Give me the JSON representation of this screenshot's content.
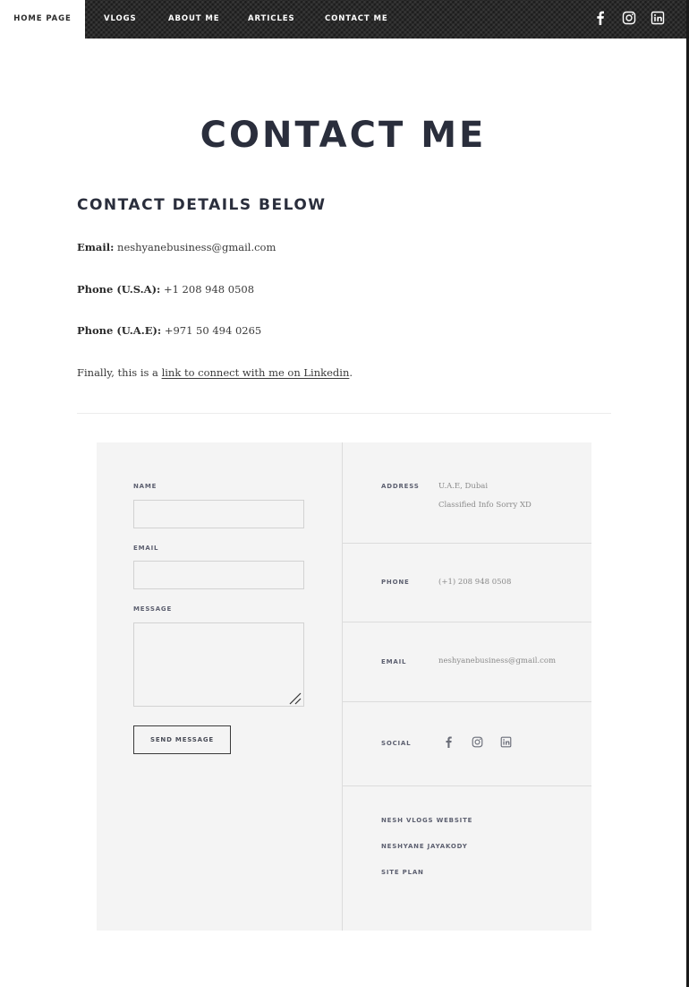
{
  "nav": {
    "items": [
      {
        "label": "HOME PAGE"
      },
      {
        "label": "VLOGS"
      },
      {
        "label": "ABOUT ME"
      },
      {
        "label": "ARTICLES"
      },
      {
        "label": "CONTACT ME"
      }
    ],
    "social_icons": [
      "facebook-icon",
      "instagram-icon",
      "linkedin-icon"
    ]
  },
  "page": {
    "title": "CONTACT ME",
    "section_heading": "CONTACT DETAILS BELOW"
  },
  "details": {
    "email_label": "Email:",
    "email_value": "neshyanebusiness@gmail.com",
    "phone_usa_label": "Phone (U.S.A):",
    "phone_usa_value": "+1 208 948 0508",
    "phone_uae_label": "Phone (U.A.E):",
    "phone_uae_value": "+971 50 494 0265",
    "linkedin_prefix": "Finally, this is a ",
    "linkedin_link": "link to connect with me on Linkedin",
    "linkedin_suffix": "."
  },
  "form": {
    "name_label": "NAME",
    "email_label": "EMAIL",
    "message_label": "MESSAGE",
    "name_value": "",
    "email_value": "",
    "message_value": "",
    "send_label": "SEND MESSAGE"
  },
  "info": {
    "address_label": "ADDRESS",
    "address_line1": "U.A.E, Dubai",
    "address_line2": "Classified Info Sorry XD",
    "phone_label": "PHONE",
    "phone_value": "(+1) 208 948 0508",
    "email_label": "EMAIL",
    "email_value": "neshyanebusiness@gmail.com",
    "social_label": "SOCIAL",
    "social_icons": [
      "facebook-icon",
      "instagram-icon",
      "linkedin-icon"
    ],
    "footer_links": [
      {
        "label": "NESH VLOGS WEBSITE"
      },
      {
        "label": "NESHYANE JAYAKODY"
      },
      {
        "label": "SITE PLAN"
      }
    ]
  },
  "colors": {
    "nav_background": "#2b2b2b",
    "heading": "#2a2e3c",
    "panel_background": "#f4f4f4",
    "muted_text": "#8a8a8a"
  }
}
